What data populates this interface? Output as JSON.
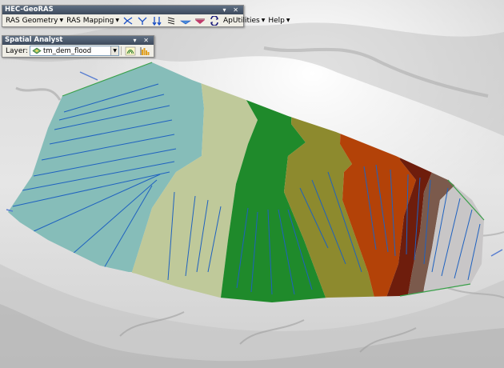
{
  "hec_toolbar": {
    "title": "HEC-GeoRAS",
    "controls": "▾ ✕",
    "menus": [
      {
        "label": "RAS Geometry"
      },
      {
        "label": "RAS Mapping"
      },
      {
        "label": "ApUtilities"
      },
      {
        "label": "Help"
      }
    ],
    "icons": [
      "stream-centerline-icon",
      "flow-paths-icon",
      "cross-sections-icon",
      "banks-icon",
      "bridges-icon",
      "levees-icon",
      "refresh-icon"
    ]
  },
  "spatial_toolbar": {
    "title": "Spatial Analyst",
    "controls": "▾ ✕",
    "layer_label": "Layer:",
    "layer_value": "tm_dem_flood",
    "icons": [
      "contour-icon",
      "histogram-icon"
    ]
  },
  "map": {
    "colors": {
      "zone1": "#86bdb9",
      "zone2": "#bfc99a",
      "zone3": "#1f8a2b",
      "zone4": "#8d8a2e",
      "zone5": "#b34208",
      "zone6": "#6e1d0c",
      "zone7": "#7b5a4c",
      "zone8": "#c8c6c7",
      "cross_section": "#1f62c0"
    }
  }
}
